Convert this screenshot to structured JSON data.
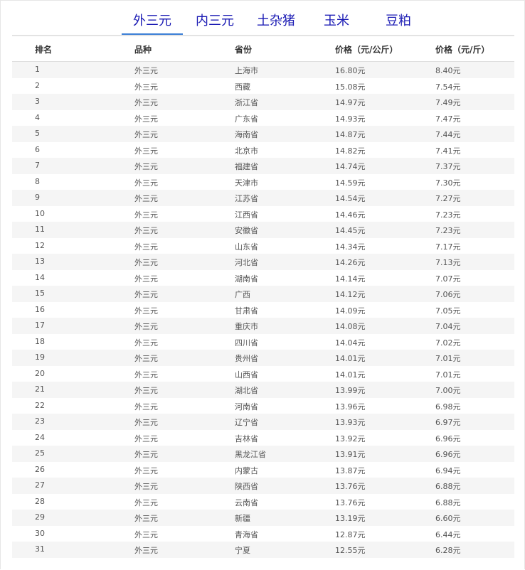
{
  "tabs": [
    {
      "label": "外三元",
      "active": true
    },
    {
      "label": "内三元",
      "active": false
    },
    {
      "label": "土杂猪",
      "active": false
    },
    {
      "label": "玉米",
      "active": false
    },
    {
      "label": "豆粕",
      "active": false
    }
  ],
  "table": {
    "headers": [
      "排名",
      "品种",
      "省份",
      "价格（元/公斤）",
      "价格（元/斤）"
    ],
    "rows": [
      [
        "1",
        "外三元",
        "上海市",
        "16.80元",
        "8.40元"
      ],
      [
        "2",
        "外三元",
        "西藏",
        "15.08元",
        "7.54元"
      ],
      [
        "3",
        "外三元",
        "浙江省",
        "14.97元",
        "7.49元"
      ],
      [
        "4",
        "外三元",
        "广东省",
        "14.93元",
        "7.47元"
      ],
      [
        "5",
        "外三元",
        "海南省",
        "14.87元",
        "7.44元"
      ],
      [
        "6",
        "外三元",
        "北京市",
        "14.82元",
        "7.41元"
      ],
      [
        "7",
        "外三元",
        "福建省",
        "14.74元",
        "7.37元"
      ],
      [
        "8",
        "外三元",
        "天津市",
        "14.59元",
        "7.30元"
      ],
      [
        "9",
        "外三元",
        "江苏省",
        "14.54元",
        "7.27元"
      ],
      [
        "10",
        "外三元",
        "江西省",
        "14.46元",
        "7.23元"
      ],
      [
        "11",
        "外三元",
        "安徽省",
        "14.45元",
        "7.23元"
      ],
      [
        "12",
        "外三元",
        "山东省",
        "14.34元",
        "7.17元"
      ],
      [
        "13",
        "外三元",
        "河北省",
        "14.26元",
        "7.13元"
      ],
      [
        "14",
        "外三元",
        "湖南省",
        "14.14元",
        "7.07元"
      ],
      [
        "15",
        "外三元",
        "广西",
        "14.12元",
        "7.06元"
      ],
      [
        "16",
        "外三元",
        "甘肃省",
        "14.09元",
        "7.05元"
      ],
      [
        "17",
        "外三元",
        "重庆市",
        "14.08元",
        "7.04元"
      ],
      [
        "18",
        "外三元",
        "四川省",
        "14.04元",
        "7.02元"
      ],
      [
        "19",
        "外三元",
        "贵州省",
        "14.01元",
        "7.01元"
      ],
      [
        "20",
        "外三元",
        "山西省",
        "14.01元",
        "7.01元"
      ],
      [
        "21",
        "外三元",
        "湖北省",
        "13.99元",
        "7.00元"
      ],
      [
        "22",
        "外三元",
        "河南省",
        "13.96元",
        "6.98元"
      ],
      [
        "23",
        "外三元",
        "辽宁省",
        "13.93元",
        "6.97元"
      ],
      [
        "24",
        "外三元",
        "吉林省",
        "13.92元",
        "6.96元"
      ],
      [
        "25",
        "外三元",
        "黑龙江省",
        "13.91元",
        "6.96元"
      ],
      [
        "26",
        "外三元",
        "内蒙古",
        "13.87元",
        "6.94元"
      ],
      [
        "27",
        "外三元",
        "陕西省",
        "13.76元",
        "6.88元"
      ],
      [
        "28",
        "外三元",
        "云南省",
        "13.76元",
        "6.88元"
      ],
      [
        "29",
        "外三元",
        "新疆",
        "13.19元",
        "6.60元"
      ],
      [
        "30",
        "外三元",
        "青海省",
        "12.87元",
        "6.44元"
      ],
      [
        "31",
        "外三元",
        "宁夏",
        "12.55元",
        "6.28元"
      ]
    ]
  }
}
